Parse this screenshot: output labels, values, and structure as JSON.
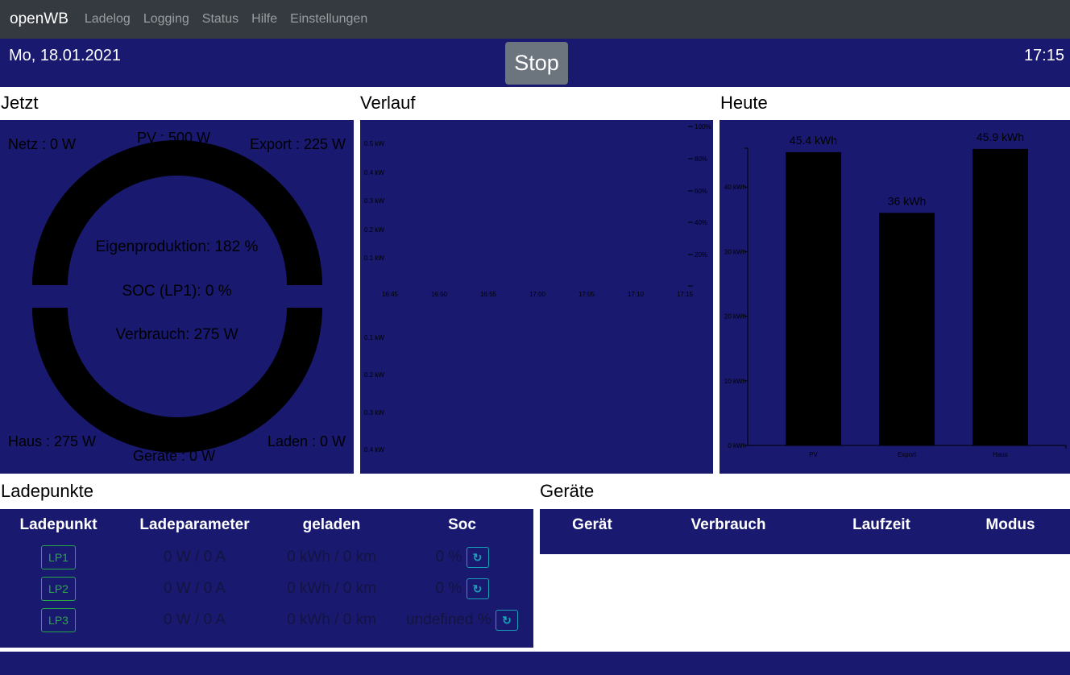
{
  "nav": {
    "brand": "openWB",
    "items": [
      "Ladelog",
      "Logging",
      "Status",
      "Hilfe",
      "Einstellungen"
    ]
  },
  "header": {
    "date": "Mo, 18.01.2021",
    "time": "17:15",
    "stop_label": "Stop"
  },
  "jetzt": {
    "title": "Jetzt",
    "netz": "Netz : 0 W",
    "pv": "PV : 500 W",
    "export": "Export : 225 W",
    "eigen": "Eigenproduktion: 182 %",
    "soc": "SOC (LP1): 0 %",
    "verbrauch": "Verbrauch: 275 W",
    "haus": "Haus : 275 W",
    "geraete": "Geräte : 0 W",
    "laden": "Laden : 0 W"
  },
  "verlauf": {
    "title": "Verlauf",
    "y_top": [
      "0.5 kW",
      "0.4 kW",
      "0.3 kW",
      "0.2 kW",
      "0.1 kW"
    ],
    "y_bottom": [
      "0.1 kW",
      "0.2 kW",
      "0.3 kW",
      "0.4 kW"
    ],
    "x": [
      "16:45",
      "16:50",
      "16:55",
      "17:00",
      "17:05",
      "17:10",
      "17:15"
    ],
    "y_right": [
      "100%",
      "80%",
      "60%",
      "40%",
      "20%"
    ]
  },
  "heute": {
    "title": "Heute"
  },
  "chart_data": {
    "type": "bar",
    "categories": [
      "PV",
      "Export",
      "Haus"
    ],
    "values": [
      45.4,
      36,
      45.9
    ],
    "labels": [
      "45.4 kWh",
      "36 kWh",
      "45.9 kWh"
    ],
    "yticks": [
      "0 kWh",
      "10 kWh",
      "20 kWh",
      "30 kWh",
      "40 kWh"
    ],
    "ylim": [
      0,
      46
    ],
    "ylabel": "",
    "xlabel": ""
  },
  "ladepunkte": {
    "title": "Ladepunkte",
    "headers": [
      "Ladepunkt",
      "Ladeparameter",
      "geladen",
      "Soc"
    ],
    "rows": [
      {
        "lp": "LP1",
        "param": "0 W / 0 A",
        "geladen": "0 kWh / 0 km",
        "soc": "0 %"
      },
      {
        "lp": "LP2",
        "param": "0 W / 0 A",
        "geladen": "0 kWh / 0 km",
        "soc": "0 %"
      },
      {
        "lp": "LP3",
        "param": "0 W / 0 A",
        "geladen": "0 kWh / 0 km",
        "soc": "undefined %"
      }
    ]
  },
  "geraete": {
    "title": "Geräte",
    "headers": [
      "Gerät",
      "Verbrauch",
      "Laufzeit",
      "Modus"
    ]
  },
  "colors": {
    "panel": "#191970",
    "nav": "#343a40",
    "lp": "#28a745",
    "refresh": "#17a2b8"
  }
}
